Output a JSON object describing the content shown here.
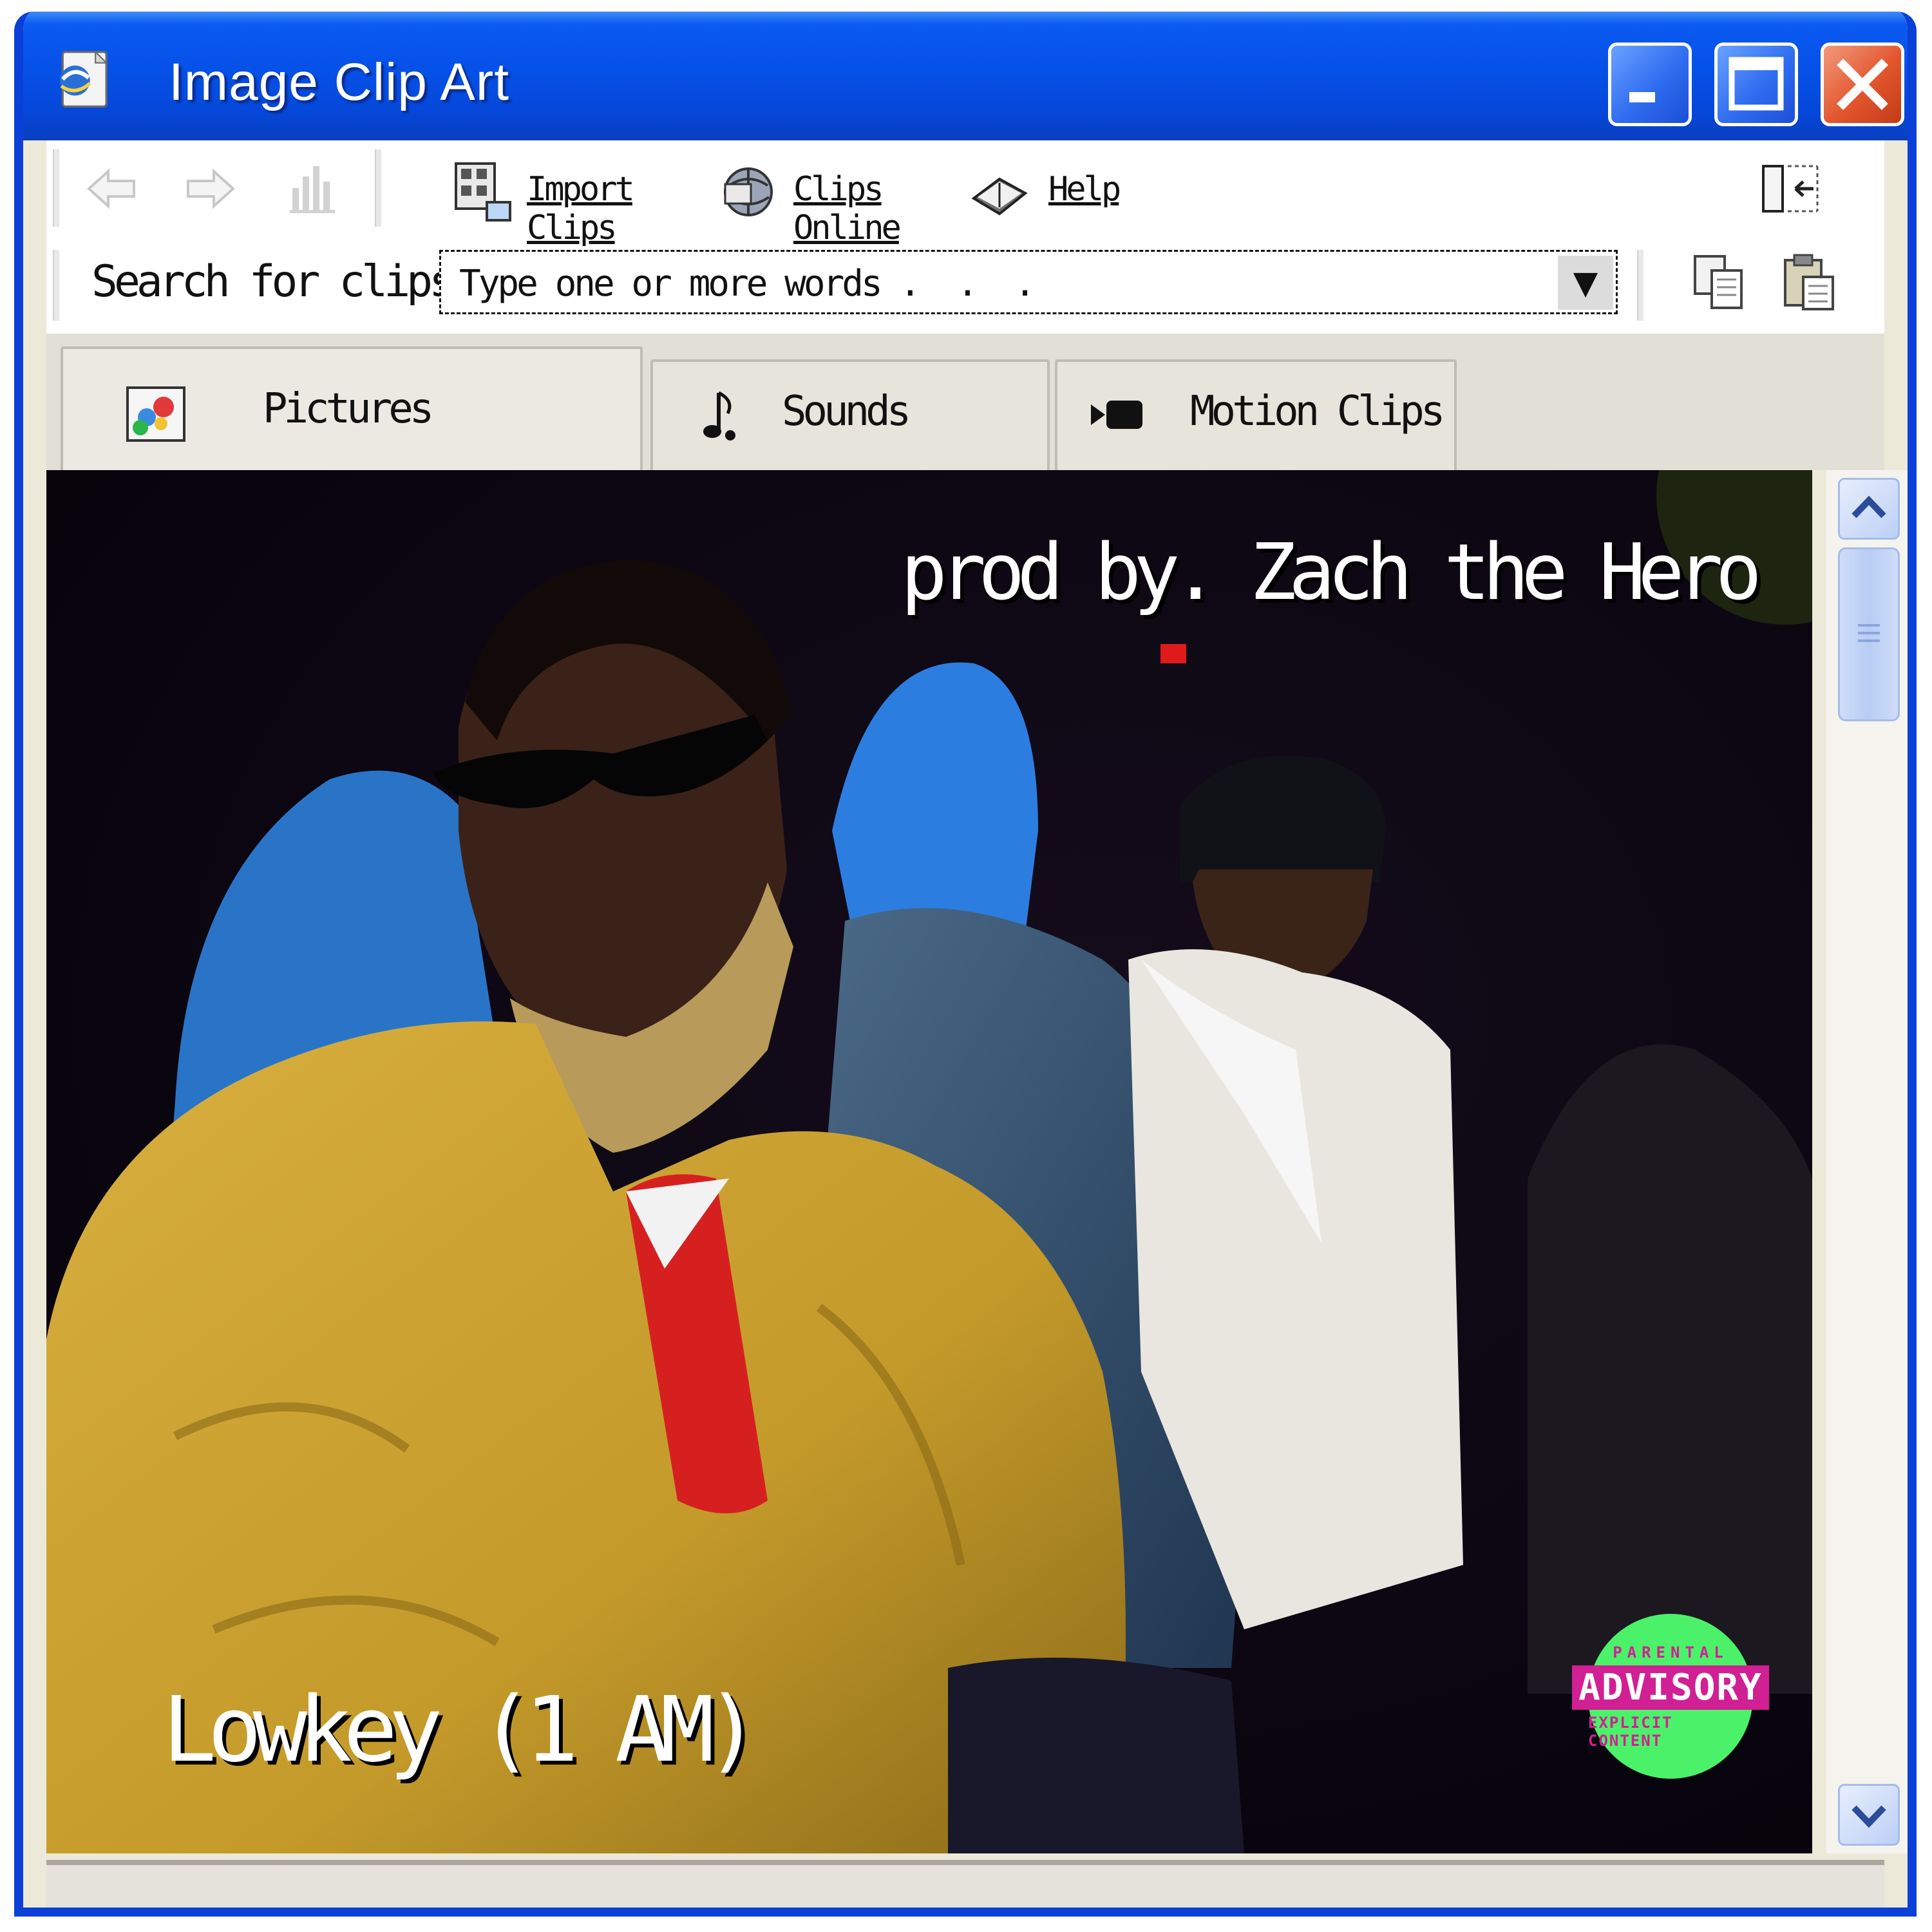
{
  "window": {
    "title": "Image Clip Art",
    "app_icon": "clip-organizer-icon"
  },
  "toolbar": {
    "back_icon": "arrow-left-icon",
    "forward_icon": "arrow-right-icon",
    "chart_icon": "bar-chart-icon",
    "import_label": "Import Clips",
    "online_label": "Clips Online",
    "help_label": "Help"
  },
  "search": {
    "label": "Search for clips:",
    "placeholder": "Type one or more words .  .  ."
  },
  "tabs": [
    {
      "label": "Pictures",
      "icon": "pictures-icon"
    },
    {
      "label": "Sounds",
      "icon": "music-note-icon"
    },
    {
      "label": "Motion Clips",
      "icon": "film-icon"
    }
  ],
  "artwork": {
    "producer": "prod by. Zach the Hero",
    "title": "Lowkey (1 AM)",
    "badge": {
      "top": "PARENTAL",
      "middle": "ADVISORY",
      "bottom": "EXPLICIT CONTENT"
    }
  },
  "colors": {
    "titlebar": "#0651e8",
    "close_button": "#e2552d",
    "badge_green": "#4cf16a",
    "badge_magenta": "#d11f94"
  }
}
